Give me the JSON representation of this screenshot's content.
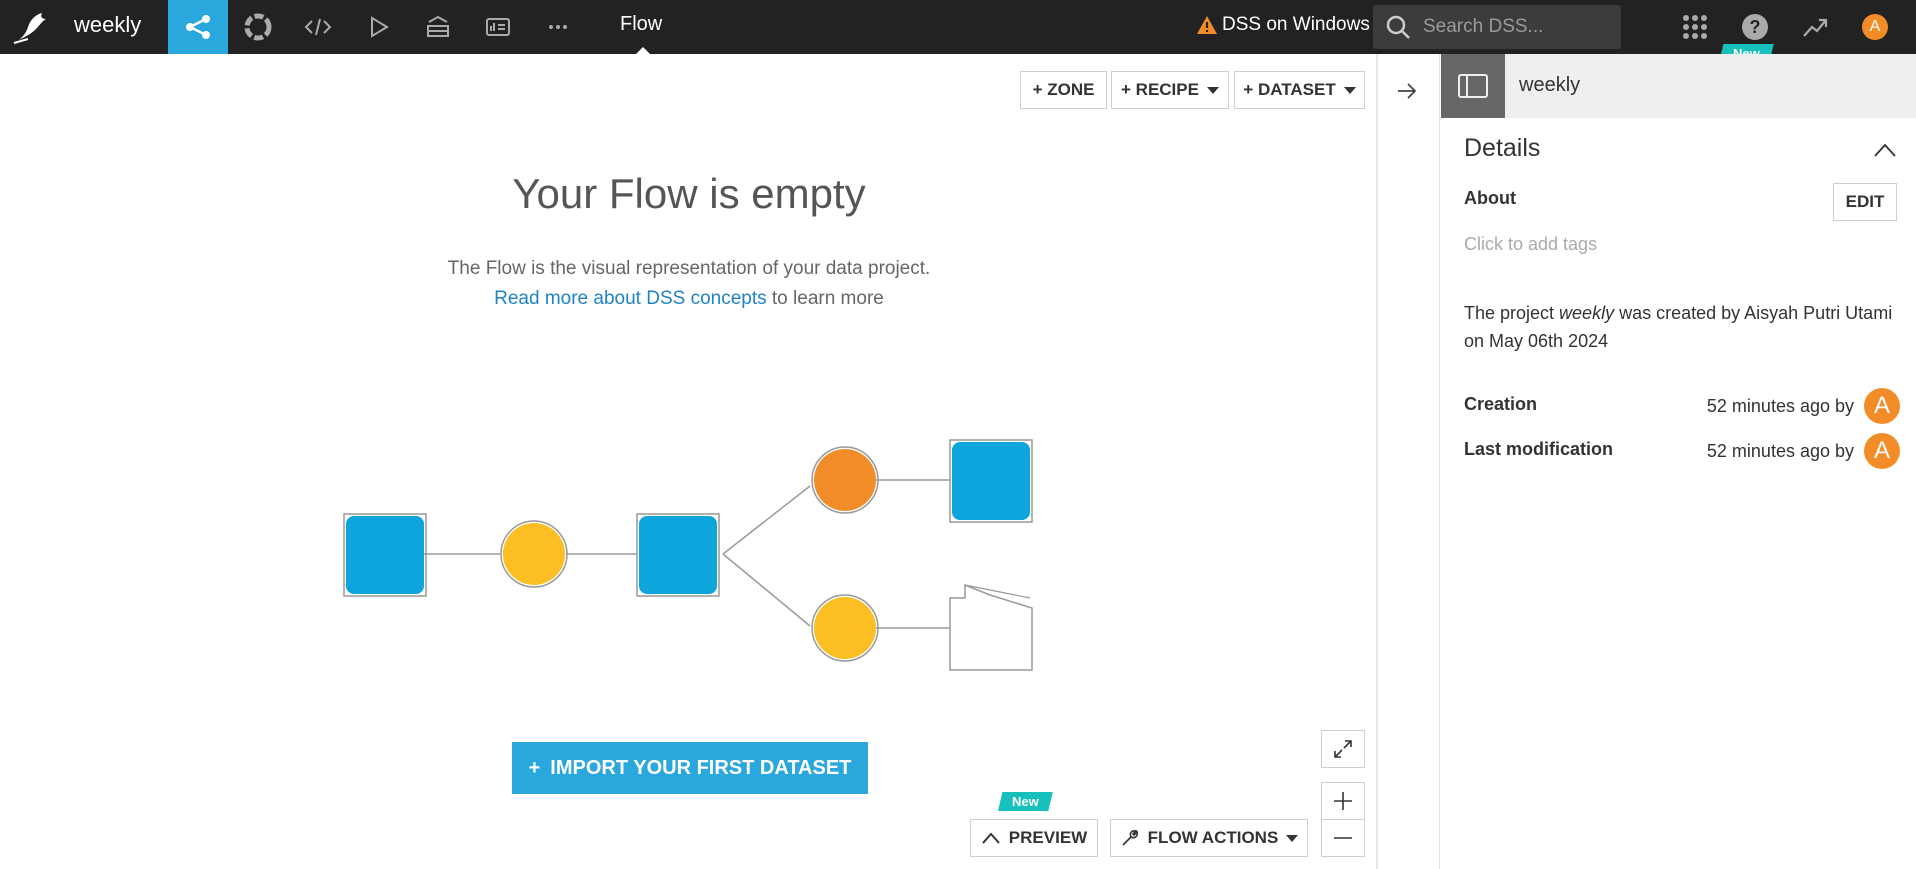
{
  "topbar": {
    "project_name": "weekly",
    "current_view": "Flow",
    "instance_name": "DSS on Windows",
    "search_placeholder": "Search DSS...",
    "new_badge": "New",
    "user_initial": "A",
    "nav_icons": [
      "flow-icon",
      "lab-icon",
      "code-icon",
      "run-icon",
      "datasets-icon",
      "dashboard-icon",
      "more-icon"
    ]
  },
  "flow": {
    "zone_label": "+ ZONE",
    "recipe_label": "+ RECIPE",
    "dataset_label": "+ DATASET",
    "empty_title": "Your Flow is empty",
    "empty_desc": "The Flow is the visual representation of your data project.",
    "concepts_link": "Read more about DSS concepts",
    "learn_more": " to learn more",
    "import_label": "IMPORT YOUR FIRST DATASET",
    "preview_label": "PREVIEW",
    "preview_badge": "New",
    "flow_actions_label": "FLOW ACTIONS"
  },
  "panel": {
    "object_name": "weekly",
    "details_title": "Details",
    "about_label": "About",
    "edit_label": "EDIT",
    "tags_hint": "Click to add tags",
    "created_prefix": "The project ",
    "created_project": "weekly",
    "created_suffix": " was created by Aisyah Putri Utami on May 06th 2024",
    "creation_label": "Creation",
    "creation_value": "52 minutes ago by",
    "modification_label": "Last modification",
    "modification_value": "52 minutes ago by",
    "avatar_initial": "A"
  },
  "colors": {
    "accent": "#2aa7dc",
    "topbar": "#222222",
    "orange": "#f28c28",
    "yellow": "#fbbf24",
    "badge": "#17c0bb",
    "link": "#2083c7"
  }
}
